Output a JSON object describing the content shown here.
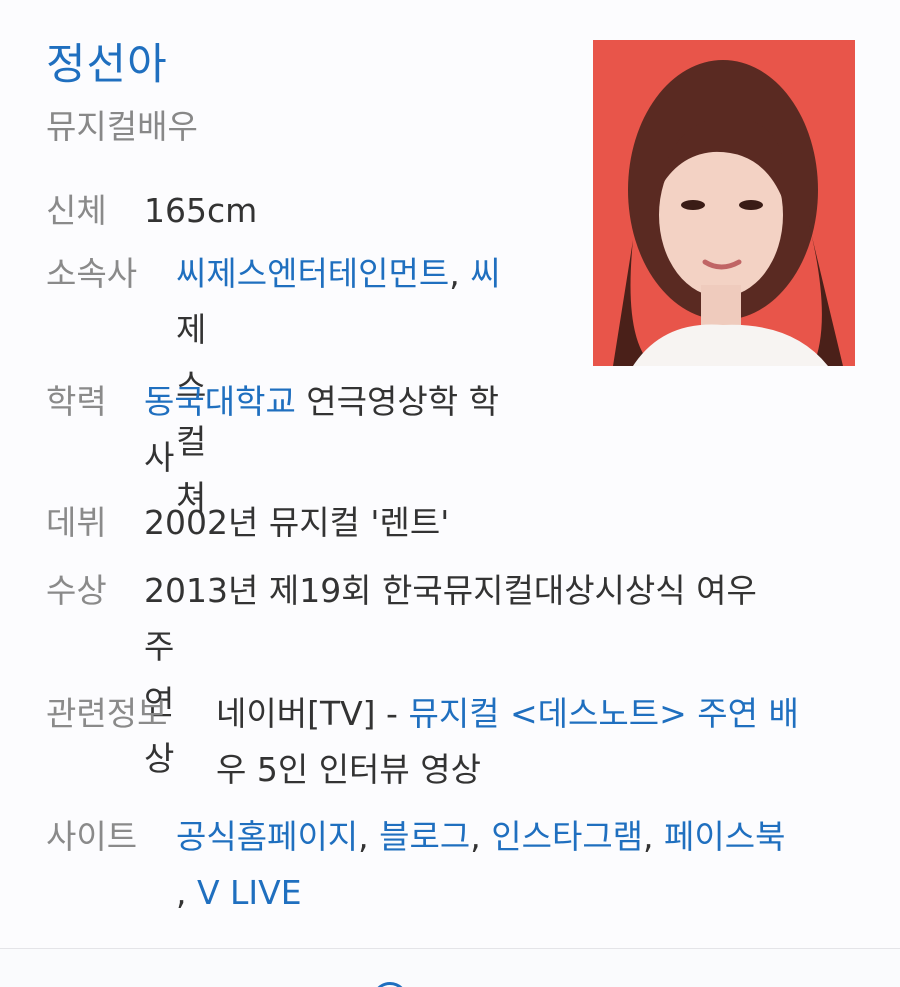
{
  "profile": {
    "name": "정선아",
    "occupation": "뮤지컬배우"
  },
  "rows": {
    "body": {
      "label": "신체",
      "value": "165cm"
    },
    "agency": {
      "label": "소속사",
      "link1": "씨제스엔터테인먼트",
      "sep": ", ",
      "link2_line1": "씨",
      "link2_line2": "제스컬쳐"
    },
    "education": {
      "label": "학력",
      "link": "동국대학교",
      "text_line1": " 연극영상학 학",
      "text_line2": "사"
    },
    "debut": {
      "label": "데뷔",
      "value": "2002년 뮤지컬 '렌트'"
    },
    "award": {
      "label": "수상",
      "line1": "2013년 제19회 한국뮤지컬대상시상식 여우",
      "line2": "주연상"
    },
    "related": {
      "label": "관련정보",
      "prefix": "네이버[TV] - ",
      "link_line1": "뮤지컬 <데스노트> 주연 배",
      "link_line2": "우 5인 인터뷰 영상"
    },
    "sites": {
      "label": "사이트",
      "items": [
        "공식홈페이지",
        "블로그",
        "인스타그램",
        "페이스북",
        "V LIVE"
      ],
      "sep": ", ",
      "lead_sep": ", "
    }
  },
  "colors": {
    "link": "#1f6fbf",
    "label": "#8a8a8a",
    "text": "#333333",
    "photo_bg": "#e9564b"
  },
  "photo": {
    "alt": "profile-photo"
  }
}
